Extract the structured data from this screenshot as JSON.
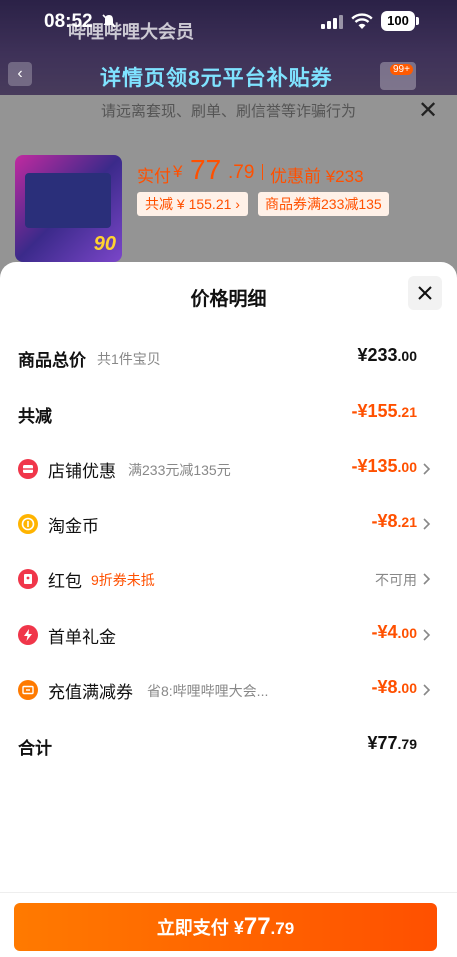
{
  "status_bar": {
    "time": "08:52",
    "battery": "100"
  },
  "background": {
    "title": "哔哩哔哩大会员",
    "banner": "详情页领8元平台补贴券",
    "cart_badge": "99+"
  },
  "order_sheet": {
    "fraud_notice": "请远离套现、刷单、刷信誉等诈骗行为",
    "thumbnail_number": "90",
    "paid_label": "实付",
    "paid_currency": "¥",
    "paid_integer": "77",
    "paid_decimal": ".79",
    "before_label": "优惠前 ¥233",
    "tags": [
      "共减 ¥ 155.21 ›",
      "商品券满233减135"
    ]
  },
  "price_detail": {
    "title": "价格明细",
    "rows": [
      {
        "label": "商品总价",
        "sub": "共1件宝贝",
        "value_main": "¥233",
        "value_small": ".00"
      },
      {
        "label": "共减",
        "sub": "",
        "value_main": "-¥155",
        "value_small": ".21"
      },
      {
        "label": "店铺优惠",
        "sub": "满233元减135元",
        "value_main": "-¥135",
        "value_small": ".00",
        "icon": "shop-coupon-icon"
      },
      {
        "label": "淘金币",
        "sub": "",
        "value_main": "-¥8",
        "value_small": ".21",
        "icon": "gold-coin-icon"
      },
      {
        "label": "红包",
        "sub": "9折券未抵",
        "value_main": "不可用",
        "value_small": "",
        "icon": "red-packet-icon"
      },
      {
        "label": "首单礼金",
        "sub": "",
        "value_main": "-¥4",
        "value_small": ".00",
        "icon": "lightning-icon"
      },
      {
        "label": "充值满减券",
        "sub": "省8:哔哩哔哩大会...",
        "value_main": "-¥8",
        "value_small": ".00",
        "icon": "coupon-ticket-icon"
      },
      {
        "label": "合计",
        "sub": "",
        "value_main": "¥77",
        "value_small": ".79"
      }
    ],
    "pay_button": {
      "label": "立即支付",
      "currency": "¥",
      "integer": "77",
      "decimal": ".79"
    }
  },
  "colors": {
    "accent": "#ff5000",
    "red_icon": "#f0364a",
    "coin_icon": "#ffb400",
    "orange_icon": "#ff7a00"
  }
}
